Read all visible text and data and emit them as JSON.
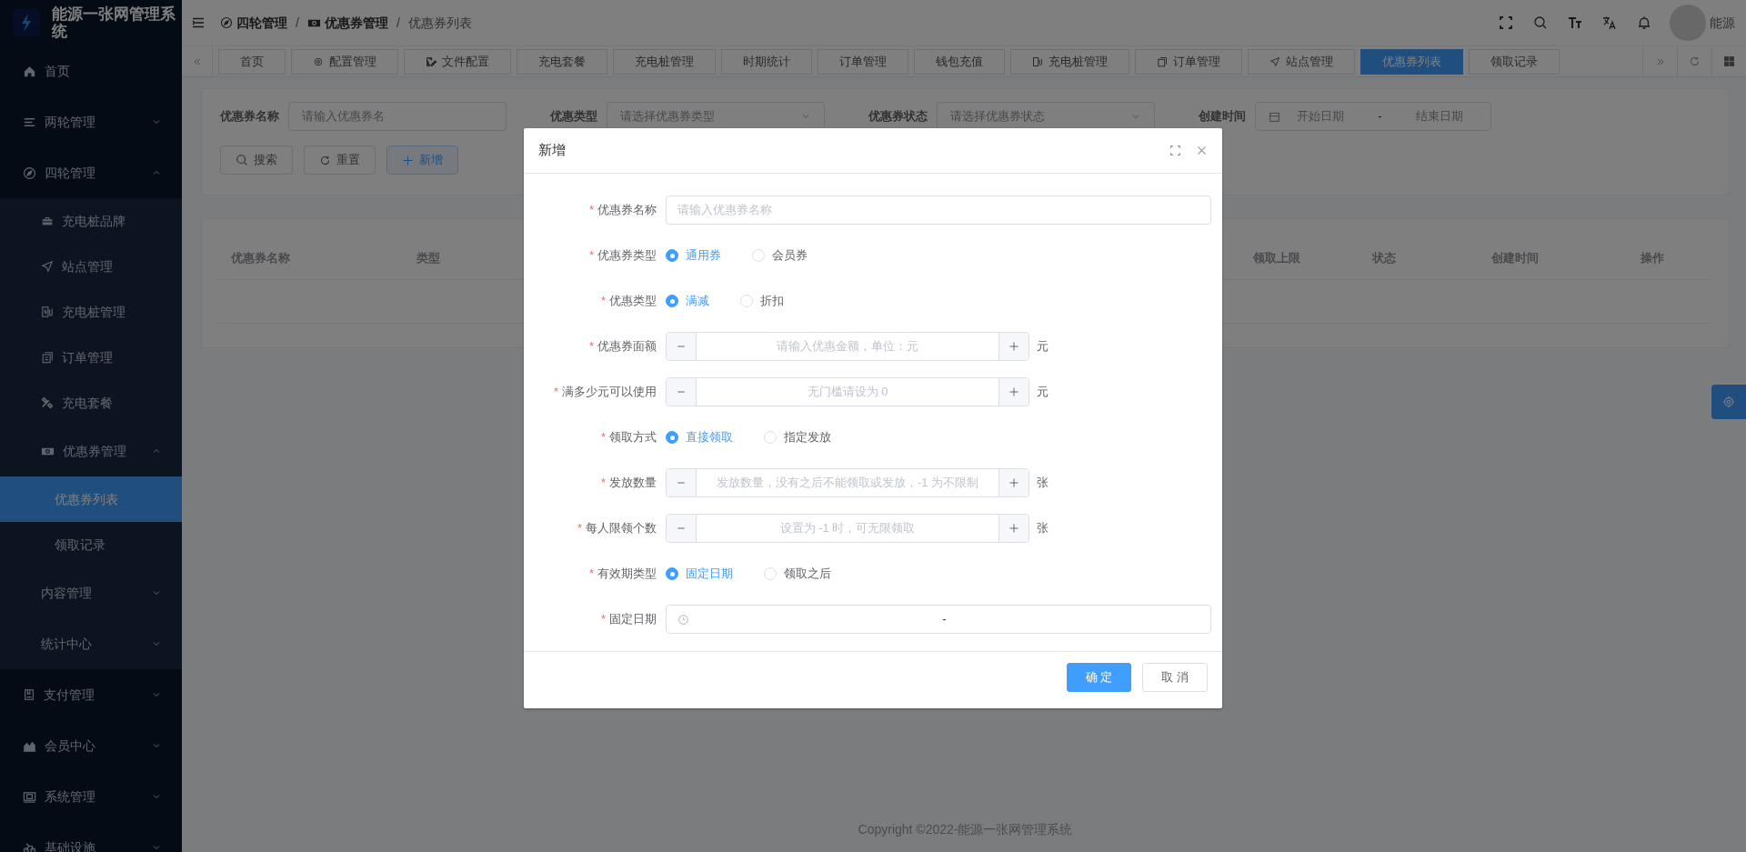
{
  "app": {
    "title": "能源一张网管理系统"
  },
  "sidebar": [
    {
      "label": "首页",
      "selected": false
    },
    {
      "label": "两轮管理",
      "selected": false,
      "expanded": false
    },
    {
      "label": "四轮管理",
      "selected": false,
      "expanded": true,
      "children": [
        {
          "label": "充电桩品牌",
          "selected": false
        },
        {
          "label": "站点管理",
          "selected": false
        },
        {
          "label": "充电桩管理",
          "selected": false
        },
        {
          "label": "订单管理",
          "selected": false
        },
        {
          "label": "充电套餐",
          "selected": false
        },
        {
          "label": "优惠券管理",
          "selected": false,
          "expanded": true,
          "children": [
            {
              "label": "优惠券列表",
              "selected": true
            },
            {
              "label": "领取记录",
              "selected": false
            }
          ]
        },
        {
          "label": "内容管理",
          "selected": false,
          "expanded": false
        },
        {
          "label": "统计中心",
          "selected": false,
          "expanded": false
        }
      ]
    },
    {
      "label": "支付管理",
      "selected": false,
      "expanded": false
    },
    {
      "label": "会员中心",
      "selected": false,
      "expanded": false
    },
    {
      "label": "系统管理",
      "selected": false,
      "expanded": false
    },
    {
      "label": "基础设施",
      "selected": false,
      "expanded": false
    }
  ],
  "breadcrumb": [
    {
      "label": "四轮管理",
      "kind": "section"
    },
    {
      "label": "优惠券管理",
      "kind": "section",
      "separator": "/"
    },
    {
      "label": "优惠券列表",
      "kind": "current",
      "separator": "/"
    }
  ],
  "user": {
    "name": "能源"
  },
  "tabs": [
    {
      "label": "首页",
      "selected": false
    },
    {
      "label": "配置管理",
      "selected": false
    },
    {
      "label": "文件配置",
      "selected": false
    },
    {
      "label": "充电套餐",
      "selected": false
    },
    {
      "label": "充电桩管理",
      "selected": false
    },
    {
      "label": "时期统计",
      "selected": false
    },
    {
      "label": "订单管理",
      "selected": false
    },
    {
      "label": "钱包充值",
      "selected": false
    },
    {
      "label": "充电桩管理",
      "selected": false
    },
    {
      "label": "订单管理",
      "selected": false
    },
    {
      "label": "站点管理",
      "selected": false
    },
    {
      "label": "优惠券列表",
      "selected": true
    },
    {
      "label": "领取记录",
      "selected": false
    }
  ],
  "filter": {
    "fields": [
      {
        "label": "优惠券名称",
        "kind": "text",
        "placeholder": "请输入优惠券名"
      },
      {
        "label": "优惠类型",
        "kind": "select",
        "placeholder": "请选择优惠券类型"
      },
      {
        "label": "优惠券状态",
        "kind": "select",
        "placeholder": "请选择优惠券状态"
      },
      {
        "label": "创建时间",
        "kind": "daterange",
        "start_placeholder": "开始日期",
        "separator": "-",
        "end_placeholder": "结束日期"
      }
    ],
    "buttons": [
      {
        "label": "搜索",
        "kind": "default"
      },
      {
        "label": "重置",
        "kind": "default"
      },
      {
        "label": "新增",
        "kind": "primary"
      }
    ]
  },
  "table": {
    "columns": [
      "优惠券名称",
      "类型",
      "领取上限",
      "状态",
      "创建时间",
      "操作"
    ]
  },
  "footer": {
    "copyright": "Copyright ©2022-能源一张网管理系统"
  },
  "dialog": {
    "title": "新增",
    "fields": [
      {
        "label": "优惠券名称",
        "kind": "text",
        "required_mark": "*",
        "placeholder": "请输入优惠券名称"
      },
      {
        "label": "优惠券类型",
        "kind": "radio",
        "required_mark": "*",
        "options": [
          {
            "label": "通用券",
            "selected": true
          },
          {
            "label": "会员券",
            "selected": false
          }
        ]
      },
      {
        "label": "优惠类型",
        "kind": "radio",
        "required_mark": "*",
        "options": [
          {
            "label": "满减",
            "selected": true
          },
          {
            "label": "折扣",
            "selected": false
          }
        ]
      },
      {
        "label": "优惠券面额",
        "kind": "number",
        "required_mark": "*",
        "placeholder": "请输入优惠金额，单位：元",
        "unit": "元"
      },
      {
        "label": "满多少元可以使用",
        "kind": "number",
        "required_mark": "*",
        "placeholder": "无门槛请设为 0",
        "unit": "元"
      },
      {
        "label": "领取方式",
        "kind": "radio",
        "required_mark": "*",
        "options": [
          {
            "label": "直接领取",
            "selected": true
          },
          {
            "label": "指定发放",
            "selected": false
          }
        ]
      },
      {
        "label": "发放数量",
        "kind": "number",
        "required_mark": "*",
        "placeholder": "发放数量，没有之后不能领取或发放，-1 为不限制",
        "unit": "张"
      },
      {
        "label": "每人限领个数",
        "kind": "number",
        "required_mark": "*",
        "placeholder": "设置为 -1 时，可无限领取",
        "unit": "张"
      },
      {
        "label": "有效期类型",
        "kind": "radio",
        "required_mark": "*",
        "options": [
          {
            "label": "固定日期",
            "selected": true
          },
          {
            "label": "领取之后",
            "selected": false
          }
        ]
      },
      {
        "label": "固定日期",
        "kind": "daterange",
        "required_mark": "*",
        "separator": "-"
      }
    ],
    "buttons": [
      {
        "label": "确 定",
        "kind": "primary"
      },
      {
        "label": "取 消",
        "kind": "default"
      }
    ]
  }
}
